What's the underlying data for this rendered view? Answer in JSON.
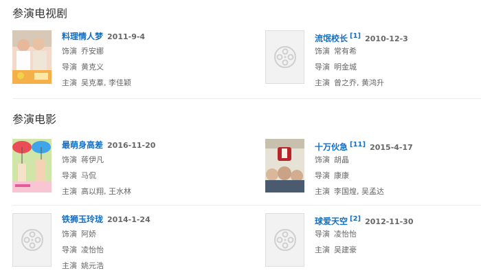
{
  "sections": {
    "tv": {
      "title": "参演电视剧",
      "items": [
        {
          "title": "料理情人梦",
          "date": "2011-9-4",
          "sup": "",
          "poster": "image",
          "rows": [
            {
              "label": "饰演",
              "value": "乔安娜"
            },
            {
              "label": "导演",
              "value": "黄克义"
            },
            {
              "label": "主演",
              "value": "吴克羣, 李佳颖"
            }
          ]
        },
        {
          "title": "流氓校长",
          "date": "2010-12-3",
          "sup": "[1]",
          "poster": "film-reel-icon",
          "rows": [
            {
              "label": "饰演",
              "value": "常有希"
            },
            {
              "label": "导演",
              "value": "明金城"
            },
            {
              "label": "主演",
              "value": "曾之乔, 黄鸿升"
            }
          ]
        }
      ]
    },
    "movies": {
      "title": "参演电影",
      "items": [
        {
          "title": "最萌身高差",
          "date": "2016-11-20",
          "sup": "",
          "poster": "image",
          "rows": [
            {
              "label": "饰演",
              "value": "蒋伊凡"
            },
            {
              "label": "导演",
              "value": "马侃"
            },
            {
              "label": "主演",
              "value": "高以翔, 王水林"
            }
          ]
        },
        {
          "title": "十万伙急",
          "date": "2015-4-17",
          "sup": "[11]",
          "poster": "image",
          "rows": [
            {
              "label": "饰演",
              "value": "胡晶"
            },
            {
              "label": "导演",
              "value": "康康"
            },
            {
              "label": "主演",
              "value": "李国煌, 吴孟达"
            }
          ]
        },
        {
          "title": "铁狮玉玲珑",
          "date": "2014-1-24",
          "sup": "",
          "poster": "film-reel-icon",
          "rows": [
            {
              "label": "饰演",
              "value": "阿娇"
            },
            {
              "label": "导演",
              "value": "凌怡怡"
            },
            {
              "label": "主演",
              "value": "姚元浩"
            }
          ]
        },
        {
          "title": "球爱天空",
          "date": "2012-11-30",
          "sup": "[2]",
          "poster": "film-reel-icon",
          "rows": [
            {
              "label": "导演",
              "value": "凌怡怡"
            },
            {
              "label": "主演",
              "value": "吴建豪"
            }
          ]
        }
      ]
    }
  }
}
